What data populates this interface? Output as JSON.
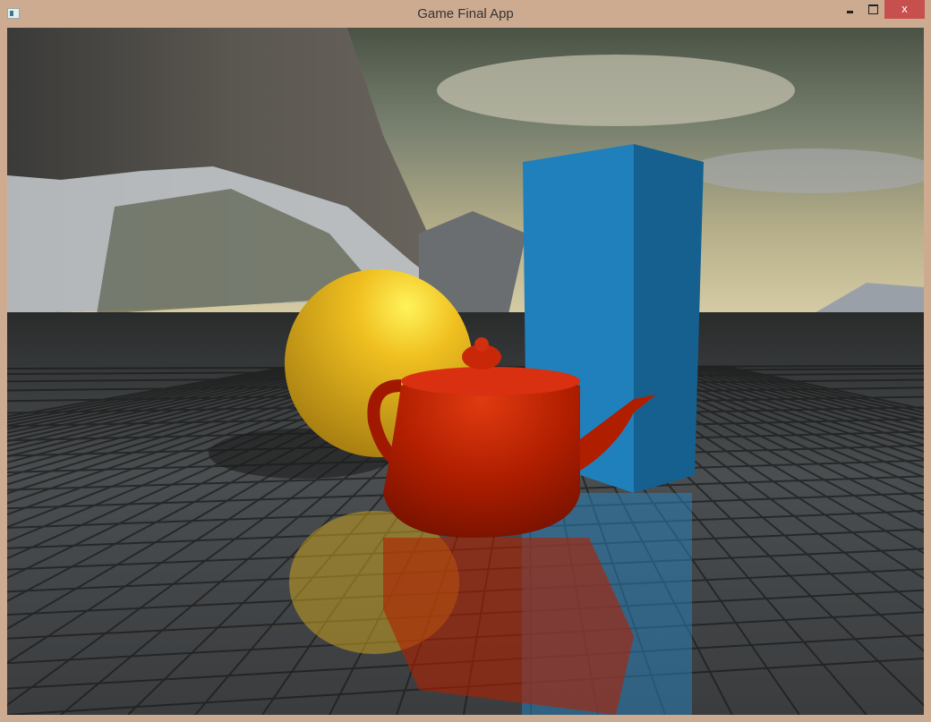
{
  "window": {
    "title": "Game Final App",
    "close_label": "x",
    "icon": "app-icon"
  },
  "scene": {
    "objects": [
      "mountain-skybox",
      "reflective-tiled-floor",
      "yellow-sphere",
      "blue-box",
      "red-teapot"
    ],
    "colors": {
      "sphere": "#e8b820",
      "box": "#1f78b0",
      "teapot": "#b82000",
      "sky": "#8a8f78"
    }
  }
}
